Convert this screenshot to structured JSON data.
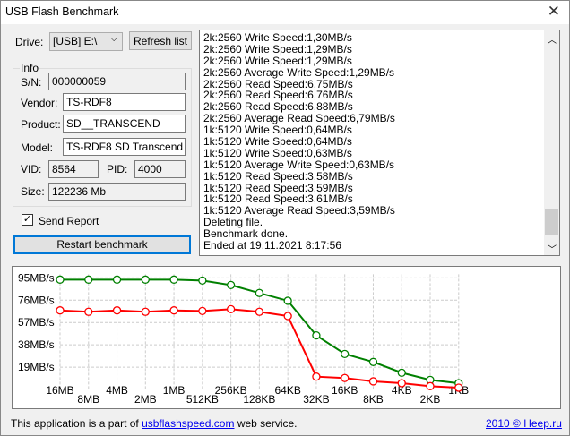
{
  "window": {
    "title": "USB Flash Benchmark"
  },
  "drive": {
    "label": "Drive:",
    "value": "[USB] E:\\",
    "refresh_label": "Refresh list"
  },
  "info": {
    "legend": "Info",
    "sn_label": "S/N:",
    "sn": "000000059",
    "vendor_label": "Vendor:",
    "vendor": "TS-RDF8",
    "product_label": "Product:",
    "product": "SD__TRANSCEND",
    "model_label": "Model:",
    "model": "TS-RDF8 SD  Transcend",
    "vid_label": "VID:",
    "vid": "8564",
    "pid_label": "PID:",
    "pid": "4000",
    "size_label": "Size:",
    "size": "122236 Mb"
  },
  "send_report": {
    "label": "Send Report",
    "checked": true
  },
  "restart_label": "Restart benchmark",
  "log": [
    "2k:2560 Write Speed:1,30MB/s",
    "2k:2560 Write Speed:1,29MB/s",
    "2k:2560 Write Speed:1,29MB/s",
    "2k:2560 Average Write Speed:1,29MB/s",
    "2k:2560 Read Speed:6,75MB/s",
    "2k:2560 Read Speed:6,76MB/s",
    "2k:2560 Read Speed:6,88MB/s",
    "2k:2560 Average Read Speed:6,79MB/s",
    "1k:5120 Write Speed:0,64MB/s",
    "1k:5120 Write Speed:0,64MB/s",
    "1k:5120 Write Speed:0,63MB/s",
    "1k:5120 Average Write Speed:0,63MB/s",
    "1k:5120 Read Speed:3,58MB/s",
    "1k:5120 Read Speed:3,59MB/s",
    "1k:5120 Read Speed:3,61MB/s",
    "1k:5120 Average Read Speed:3,59MB/s",
    "Deleting file.",
    "Benchmark done.",
    "Ended at 19.11.2021 8:17:56"
  ],
  "chart_data": {
    "type": "line",
    "categories": [
      "16MB",
      "8MB",
      "4MB",
      "2MB",
      "1MB",
      "512KB",
      "256KB",
      "128KB",
      "64KB",
      "32KB",
      "16KB",
      "8KB",
      "4KB",
      "2KB",
      "1KB"
    ],
    "yticks": [
      "19MB/s",
      "38MB/s",
      "57MB/s",
      "76MB/s",
      "95MB/s"
    ],
    "ytick_values": [
      19,
      38,
      57,
      76,
      95
    ],
    "ylim": [
      0,
      95
    ],
    "grid": true,
    "series": [
      {
        "color": "#008000",
        "values": [
          93.5,
          93.5,
          93.5,
          93.5,
          93.5,
          92.7,
          88.9,
          82.1,
          75.5,
          46,
          30.2,
          23.4,
          14.2,
          8.1,
          5.3
        ]
      },
      {
        "color": "#ff0000",
        "values": [
          67.3,
          66.1,
          67.3,
          66.1,
          67.3,
          66.8,
          68.3,
          66.1,
          62.5,
          10.9,
          9.7,
          6.9,
          5.3,
          2.8,
          1.5
        ]
      }
    ]
  },
  "footer": {
    "prefix": "This application is a part of ",
    "link": "usbflashspeed.com",
    "suffix": " web service.",
    "right_link": "2010 © Heep.ru"
  }
}
